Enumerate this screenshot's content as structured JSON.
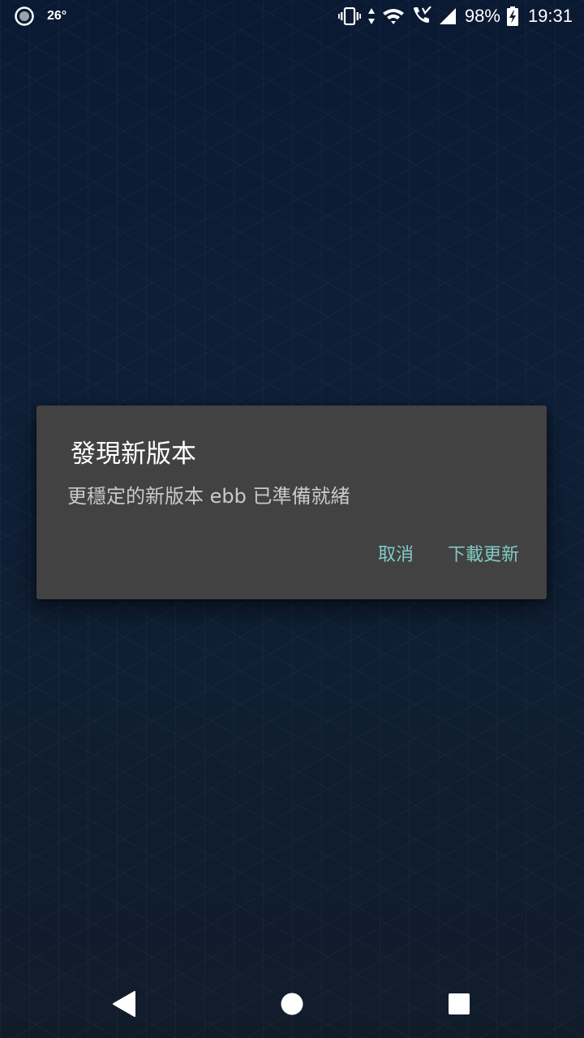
{
  "status_bar": {
    "temperature": "26°",
    "battery_percent": "98%",
    "time": "19:31",
    "icons": [
      "weather-icon",
      "vibrate-icon",
      "data-arrows-icon",
      "wifi-icon",
      "phone-call-icon",
      "signal-icon",
      "battery-charging-icon"
    ]
  },
  "dialog": {
    "title": "發現新版本",
    "message": "更穩定的新版本 ebb 已準備就緒",
    "cancel_label": "取消",
    "download_label": "下載更新",
    "accent_color": "#80cbc4",
    "background_color": "#424242"
  },
  "nav_bar": {
    "icons": [
      "back-icon",
      "home-icon",
      "recents-icon"
    ]
  }
}
